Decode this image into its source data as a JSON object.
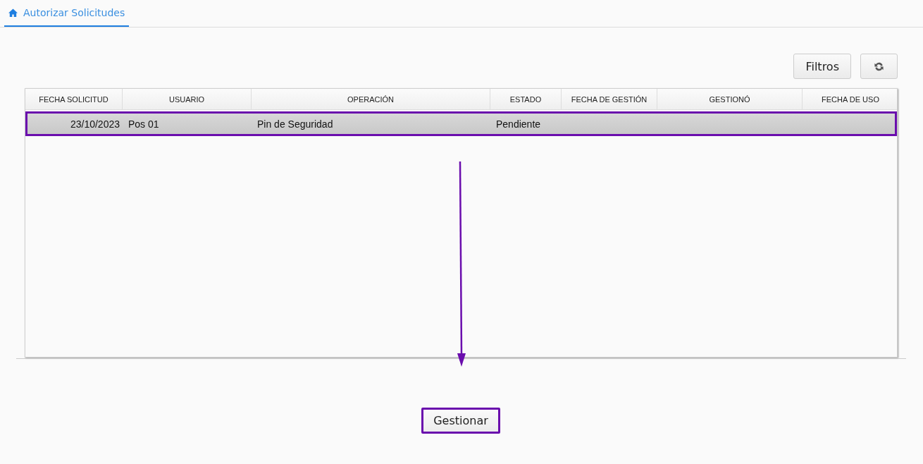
{
  "tabs": [
    {
      "label": "Autorizar Solicitudes",
      "selected": true
    }
  ],
  "toolbar": {
    "buttons": [
      {
        "kind": "text",
        "label": "Filtros"
      },
      {
        "kind": "refresh"
      }
    ]
  },
  "table": {
    "columns": [
      "FECHA SOLICITUD",
      "USUARIO",
      "OPERACIÓN",
      "ESTADO",
      "FECHA DE GESTIÓN",
      "GESTIONÓ",
      "FECHA DE USO"
    ],
    "rows": [
      {
        "cells": [
          "23/10/2023",
          "Pos 01",
          "Pin de Seguridad",
          "Pendiente",
          "",
          "",
          ""
        ],
        "selected": true,
        "highlighted": true
      }
    ]
  },
  "action": {
    "label": "Gestionar",
    "highlighted": true
  },
  "annotation": {
    "arrow": true
  }
}
